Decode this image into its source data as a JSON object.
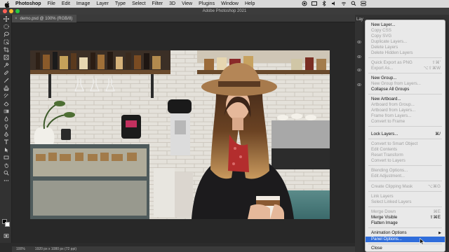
{
  "menubar": {
    "app": "Photoshop",
    "items": [
      "File",
      "Edit",
      "Image",
      "Layer",
      "Type",
      "Select",
      "Filter",
      "3D",
      "View",
      "Plugins",
      "Window",
      "Help"
    ]
  },
  "window": {
    "title": "Adobe Photoshop 2021"
  },
  "document": {
    "tab_label": "demo.psd @ 100% (RGB/8)",
    "close_glyph": "×"
  },
  "status": {
    "zoom": "100%",
    "doc_info": "1920 px x 1080 px (72 ppi)"
  },
  "panel": {
    "tab_label": "Lay"
  },
  "menu": {
    "items": [
      {
        "label": "New Layer...",
        "shortcut": "",
        "disabled": false
      },
      {
        "label": "Copy CSS",
        "shortcut": "",
        "disabled": true
      },
      {
        "label": "Copy SVG",
        "shortcut": "",
        "disabled": true
      },
      {
        "label": "Duplicate Layers...",
        "shortcut": "",
        "disabled": true
      },
      {
        "label": "Delete Layers",
        "shortcut": "",
        "disabled": true
      },
      {
        "label": "Delete Hidden Layers",
        "shortcut": "",
        "disabled": true
      },
      {
        "label": "Quick Export as PNG",
        "shortcut": "⇧⌘'",
        "disabled": true
      },
      {
        "label": "Export As...",
        "shortcut": "⌥⇧⌘W",
        "disabled": true
      },
      {
        "label": "New Group...",
        "shortcut": "",
        "disabled": false
      },
      {
        "label": "New Group from Layers...",
        "shortcut": "",
        "disabled": true
      },
      {
        "label": "Collapse All Groups",
        "shortcut": "",
        "disabled": false
      },
      {
        "label": "New Artboard...",
        "shortcut": "",
        "disabled": false
      },
      {
        "label": "Artboard from Group...",
        "shortcut": "",
        "disabled": true
      },
      {
        "label": "Artboard from Layers...",
        "shortcut": "",
        "disabled": true
      },
      {
        "label": "Frame from Layers...",
        "shortcut": "",
        "disabled": true
      },
      {
        "label": "Convert to Frame",
        "shortcut": "",
        "disabled": true
      },
      {
        "label": "Lock Layers...",
        "shortcut": "⌘/",
        "disabled": false
      },
      {
        "label": "Convert to Smart Object",
        "shortcut": "",
        "disabled": true
      },
      {
        "label": "Edit Contents",
        "shortcut": "",
        "disabled": true
      },
      {
        "label": "Reset Transform",
        "shortcut": "",
        "disabled": true
      },
      {
        "label": "Convert to Layers",
        "shortcut": "",
        "disabled": true
      },
      {
        "label": "Blending Options...",
        "shortcut": "",
        "disabled": true
      },
      {
        "label": "Edit Adjustment...",
        "shortcut": "",
        "disabled": true
      },
      {
        "label": "Create Clipping Mask",
        "shortcut": "⌥⌘G",
        "disabled": true
      },
      {
        "label": "Link Layers",
        "shortcut": "",
        "disabled": true
      },
      {
        "label": "Select Linked Layers",
        "shortcut": "",
        "disabled": true
      },
      {
        "label": "Merge Down",
        "shortcut": "⌘E",
        "disabled": true
      },
      {
        "label": "Merge Visible",
        "shortcut": "⇧⌘E",
        "disabled": false
      },
      {
        "label": "Flatten Image",
        "shortcut": "",
        "disabled": false
      },
      {
        "label": "Animation Options",
        "shortcut": "",
        "disabled": false,
        "submenu": true
      },
      {
        "label": "Panel Options...",
        "shortcut": "",
        "disabled": false,
        "highlighted": true
      },
      {
        "label": "Close",
        "shortcut": "",
        "disabled": false
      }
    ]
  },
  "colors": {
    "highlight": "#2f6ddb",
    "menu_bg": "#e9e9e9",
    "app_bg": "#2b2b2b"
  }
}
